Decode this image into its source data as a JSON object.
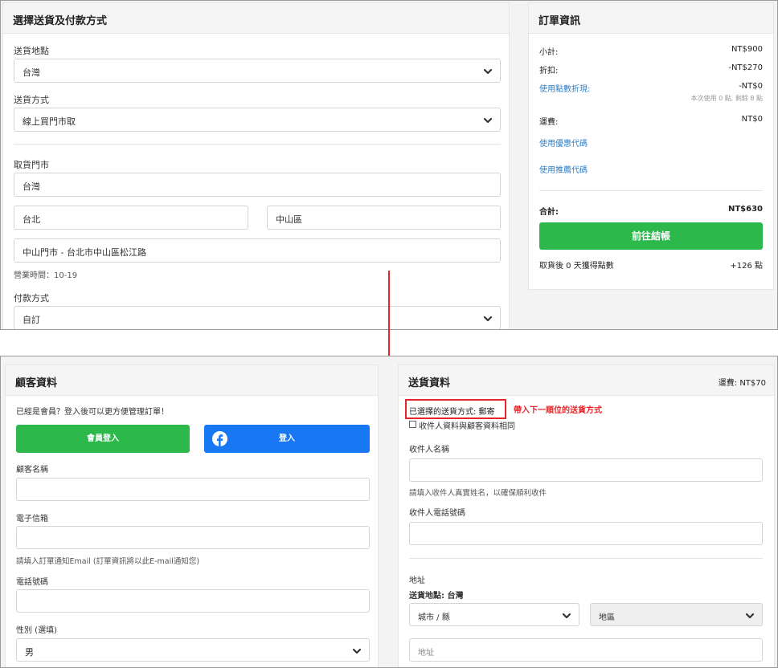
{
  "top": {
    "method_card": {
      "title": "選擇送貨及付款方式",
      "location_label": "送貨地點",
      "location_value": "台灣",
      "shipping_label": "送貨方式",
      "shipping_value": "線上買門市取",
      "store_label": "取貨門市",
      "store_country": "台灣",
      "store_city": "台北",
      "store_district": "中山區",
      "store_name": "中山門市 - 台北市中山區松江路",
      "hours": "營業時間：10-19",
      "payment_label": "付款方式",
      "payment_value": "自訂"
    },
    "order_card": {
      "title": "訂單資訊",
      "subtotal_label": "小計:",
      "subtotal_value": "NT$900",
      "discount_label": "折扣:",
      "discount_value": "-NT$270",
      "points_label": "使用點數折現:",
      "points_value": "-NT$0",
      "points_note": "本次使用 0 點, 剩餘 8 點",
      "shipping_fee_label": "運費:",
      "shipping_fee_value": "NT$0",
      "coupon_link": "使用優惠代碼",
      "referral_link": "使用推薦代碼",
      "total_label": "合計:",
      "total_value": "NT$630",
      "checkout_button": "前往結帳",
      "reward_label": "取貨後 0 天獲得點數",
      "reward_value": "+126 點"
    }
  },
  "bottom": {
    "customer_card": {
      "title": "顧客資料",
      "member_prompt": "已經是會員？登入後可以更方便管理訂單！",
      "member_login_button": "會員登入",
      "facebook_login_button": "登入",
      "name_label": "顧客名稱",
      "email_label": "電子信箱",
      "email_hint": "請填入訂單通知Email (訂單資訊將以此E-mail通知您)",
      "phone_label": "電話號碼",
      "gender_label": "性別 (選填)",
      "gender_value": "男"
    },
    "delivery_card": {
      "title": "送貨資料",
      "fee": "運費: NT$70",
      "selected_method": "已選擇的送貨方式: 郵寄",
      "annotation": "帶入下一順位的送貨方式",
      "same_as_customer": "收件人資料與顧客資料相同",
      "recipient_name_label": "收件人名稱",
      "recipient_name_hint": "請填入收件人真實姓名，以確保順利收件",
      "recipient_phone_label": "收件人電話號碼",
      "address_label": "地址",
      "delivery_location": "送貨地點: 台灣",
      "city_placeholder": "城市 / 縣",
      "district_placeholder": "地區",
      "address_placeholder": "地址"
    }
  },
  "colors": {
    "green": "#2db84c",
    "facebook": "#1877f2",
    "link": "#2a7fc9",
    "annotation_red": "#e8262a"
  }
}
